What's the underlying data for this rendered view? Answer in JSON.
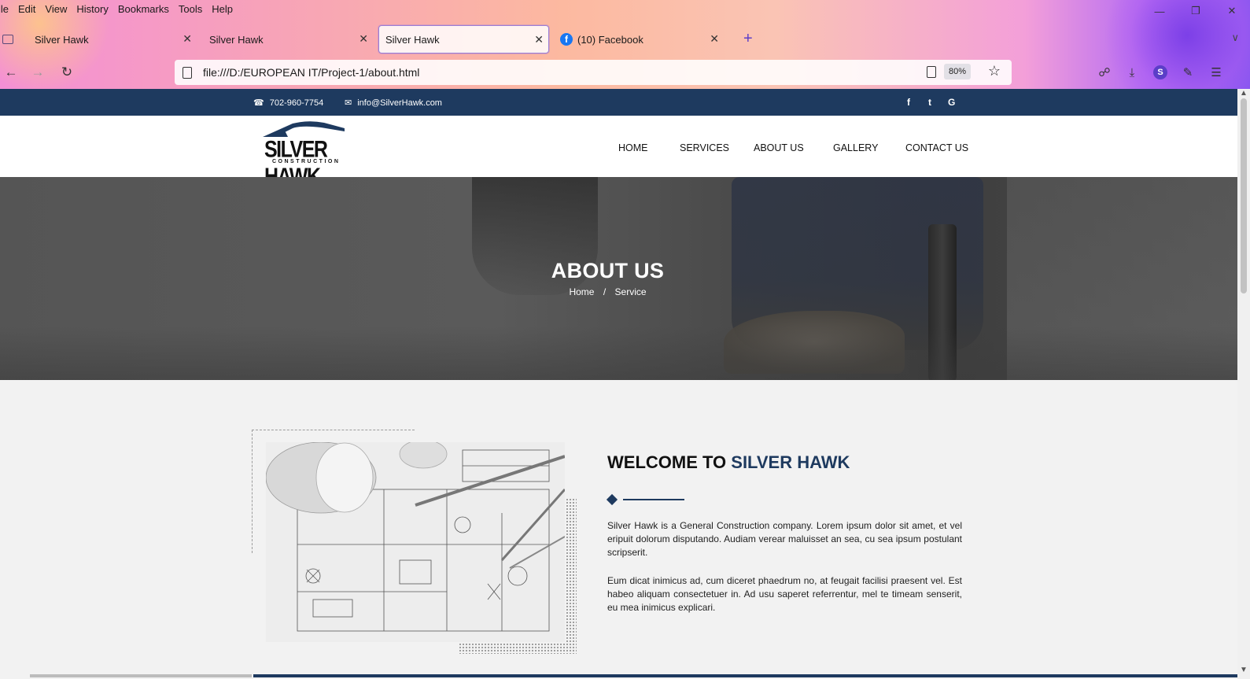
{
  "browser": {
    "menu": [
      "ile",
      "Edit",
      "View",
      "History",
      "Bookmarks",
      "Tools",
      "Help"
    ],
    "tabs": [
      {
        "label": "Silver Hawk",
        "active": false,
        "close": "✕"
      },
      {
        "label": "Silver Hawk",
        "active": false,
        "close": "✕"
      },
      {
        "label": "Silver Hawk",
        "active": true,
        "close": "✕"
      },
      {
        "label": "(10) Facebook",
        "active": false,
        "close": "✕",
        "icon": "facebook-icon"
      }
    ],
    "new_tab": "+",
    "url": "file:///D:/EUROPEAN IT/Project-1/about.html",
    "zoom": "80%",
    "profile_initial": "S"
  },
  "site": {
    "topbar": {
      "phone": "702-960-7754",
      "email": "info@SilverHawk.com",
      "social": [
        "f",
        "t",
        "G"
      ]
    },
    "logo": {
      "word": "SILVER HAWK",
      "sub": "CONSTRUCTION"
    },
    "nav": [
      "HOME",
      "SERVICES",
      "ABOUT US",
      "GALLERY",
      "CONTACT US"
    ],
    "hero": {
      "title": "ABOUT US",
      "breadcrumb": {
        "home": "Home",
        "sep": "/",
        "current": "Service"
      }
    },
    "about": {
      "title_prefix": "WELCOME TO ",
      "title_accent": "SILVER HAWK",
      "para1": "Silver Hawk is a General Construction company. Lorem ipsum dolor sit amet, et vel eripuit dolorum disputando. Audiam verear maluisset an sea, cu sea ipsum postulant scripserit.",
      "para2": "Eum dicat inimicus ad, cum diceret phaedrum no, at feugait facilisi praesent vel. Est habeo aliquam consectetuer in. Ad usu saperet referrentur, mel te timeam senserit, eu mea inimicus explicari."
    },
    "colors": {
      "brand_navy": "#1e3a5f"
    }
  }
}
